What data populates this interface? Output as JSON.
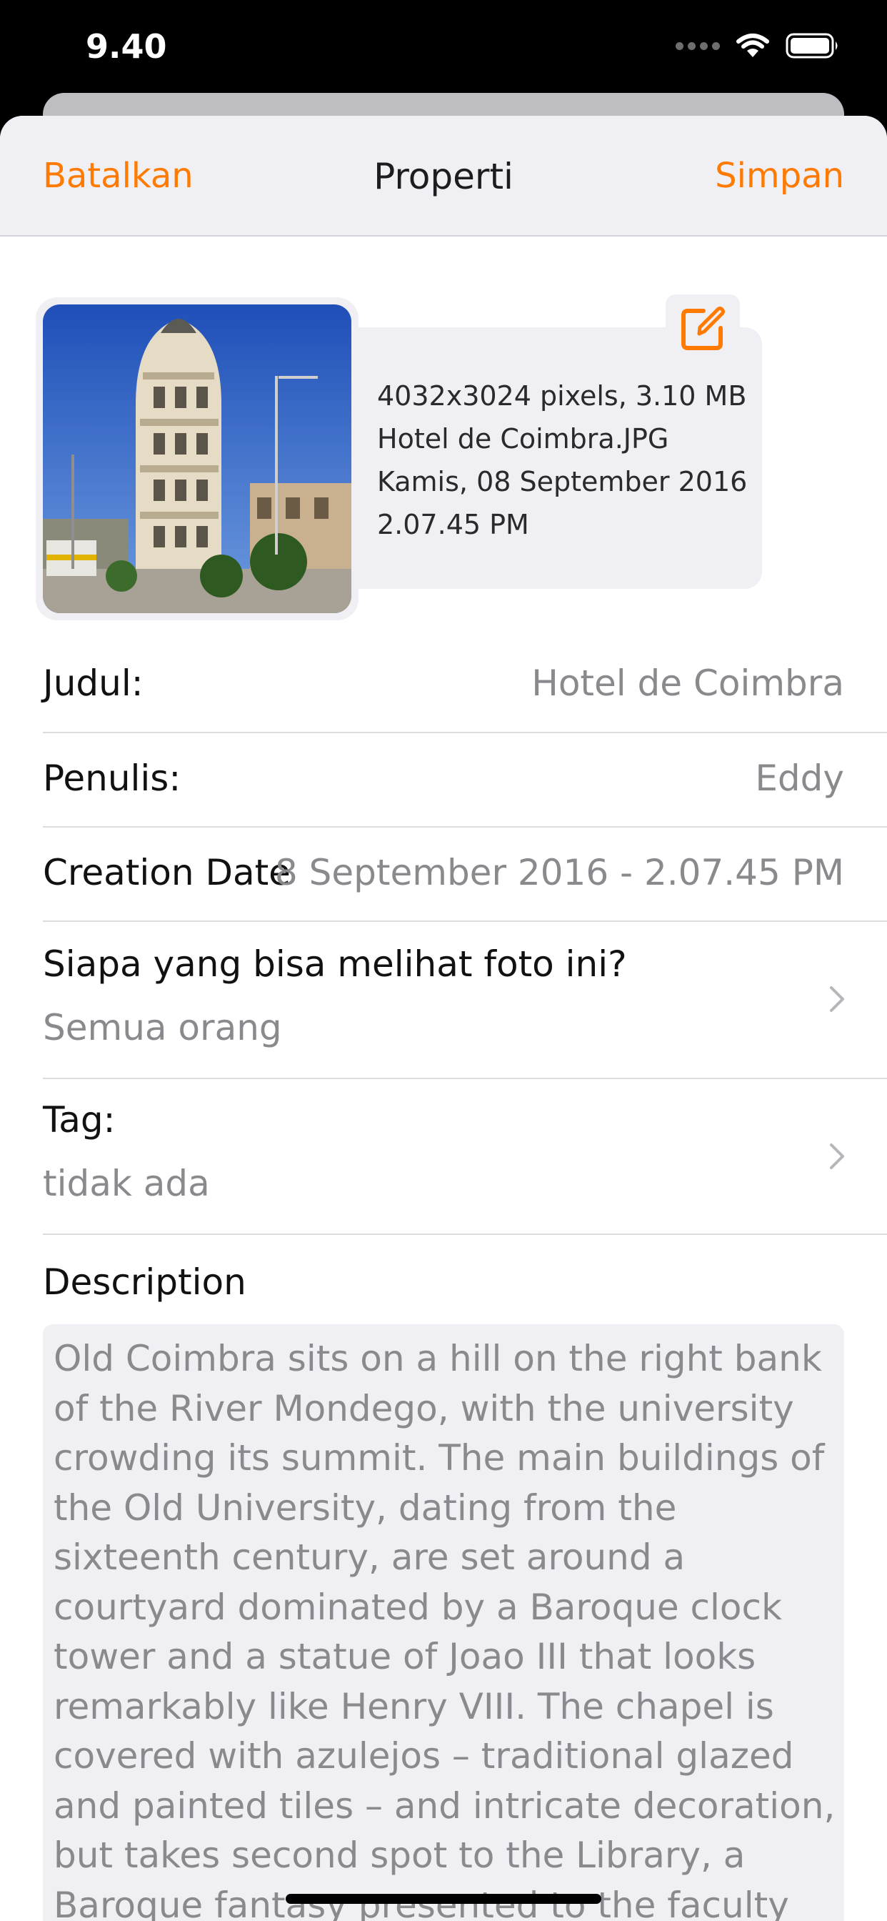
{
  "status_bar": {
    "time": "9.40"
  },
  "nav": {
    "cancel": "Batalkan",
    "title": "Properti",
    "save": "Simpan"
  },
  "photo_info": {
    "line1": "4032x3024 pixels, 3.10 MB",
    "line2": "Hotel de Coimbra.JPG",
    "line3": "Kamis, 08 September 2016",
    "line4": "2.07.45 PM"
  },
  "fields": {
    "title_label": "Judul:",
    "title_value": "Hotel de Coimbra",
    "author_label": "Penulis:",
    "author_value": "Eddy",
    "creation_label": "Creation Date",
    "creation_value": "8 September 2016 - 2.07.45 PM",
    "visibility_label": "Siapa yang bisa melihat foto ini?",
    "visibility_value": "Semua orang",
    "tags_label": "Tag:",
    "tags_value": "tidak ada"
  },
  "description": {
    "heading": "Description",
    "text": "Old Coimbra sits on a hill on the right bank of the River Mondego, with the university crowding its summit. The main buildings of the Old University, dating from the sixteenth century, are set around a courtyard dominated by a Baroque clock tower and a statue of Joao III that looks remarkably like Henry VIII. The chapel is covered with azulejos – traditional glazed and painted tiles – and intricate decoration, but takes second spot to the Library, a Baroque fantasy presented to the faculty by Joao V in the early eighteenth"
  },
  "colors": {
    "accent": "#ff7a00",
    "secondary_text": "#8a8a8e",
    "card_bg": "#efeff4"
  },
  "icons": [
    "wifi-icon",
    "battery-icon",
    "edit-icon",
    "chevron-right-icon"
  ]
}
